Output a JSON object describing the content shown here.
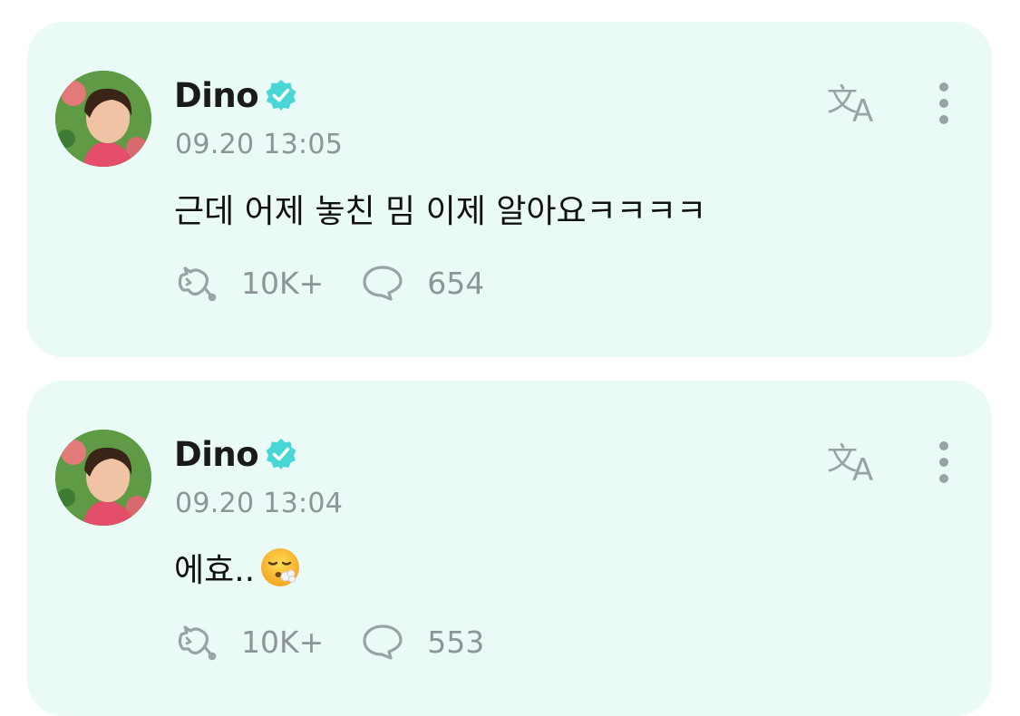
{
  "posts": [
    {
      "author": "Dino",
      "time": "09.20 13:05",
      "text": "근데 어제 놓친 밈 이제 알아요ㅋㅋㅋㅋ",
      "has_emoji": false,
      "likes": "10K+",
      "comments": "654"
    },
    {
      "author": "Dino",
      "time": "09.20 13:04",
      "text": "에효..",
      "has_emoji": true,
      "emoji_name": "face-exhaling",
      "likes": "10K+",
      "comments": "553"
    }
  ],
  "icons": {
    "verified": "verified-badge-icon",
    "translate": "translate-icon",
    "more": "more-vertical-icon",
    "like": "like-icon",
    "comment": "comment-icon"
  },
  "colors": {
    "card_bg": "#eafaf7",
    "accent": "#49d7d5",
    "muted_text": "#8e9596",
    "icon_gray": "#9aa3a4"
  }
}
